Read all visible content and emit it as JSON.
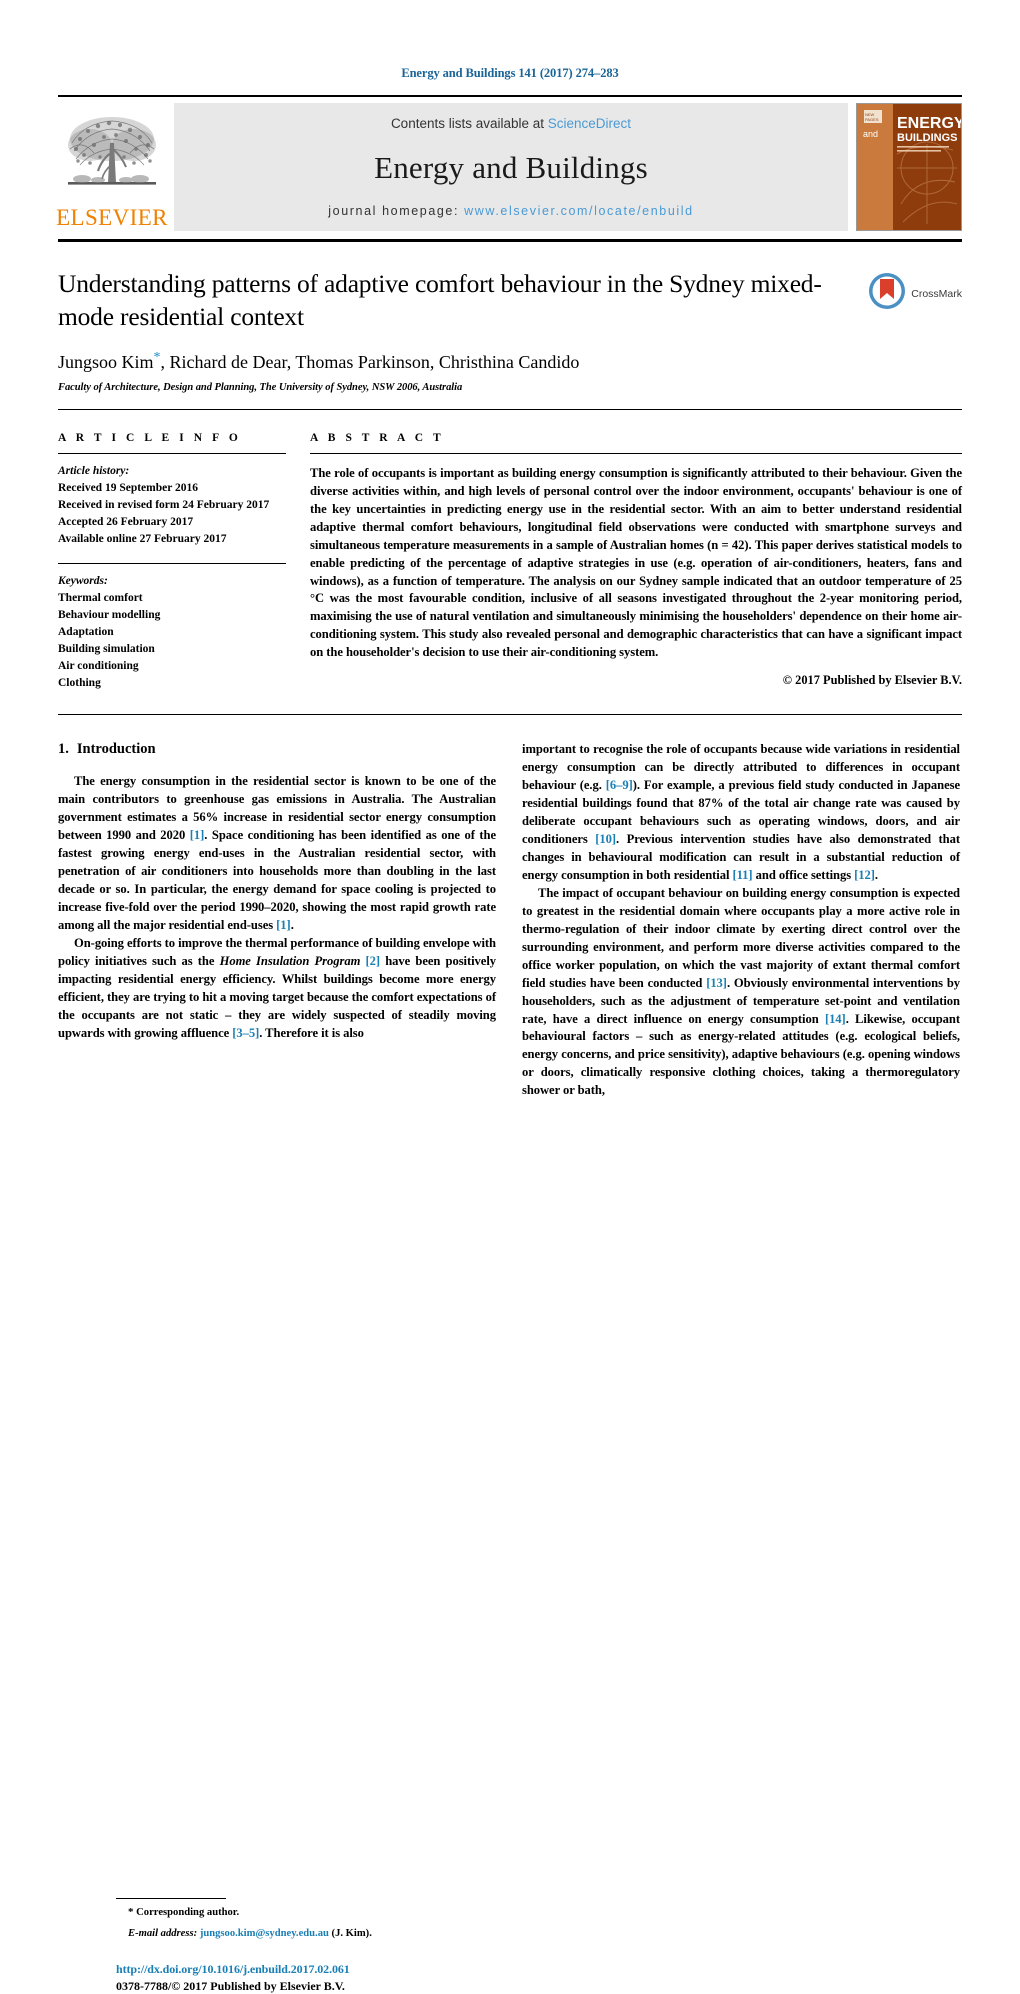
{
  "running_head": "Energy and Buildings 141 (2017) 274–283",
  "masthead": {
    "contents_prefix": "Contents lists available at ",
    "sciencedirect": "ScienceDirect",
    "journal_name": "Energy and Buildings",
    "homepage_prefix": "journal homepage: ",
    "homepage_url": "www.elsevier.com/locate/enbuild",
    "publisher_logo_text": "ELSEVIER",
    "cover_title_line1": "ENERGY",
    "cover_title_line2": "BUILDINGS",
    "cover_and": "and",
    "accent_blue": "#4a9ad4",
    "accent_orange": "#F08000",
    "cover_brown": "#8a3a10"
  },
  "article": {
    "title": "Understanding patterns of adaptive comfort behaviour in the Sydney mixed-mode residential context",
    "authors": "Jungsoo Kim",
    "authors_rest": ", Richard de Dear, Thomas Parkinson, Christhina Candido",
    "corresponding_marker": "*",
    "affiliation": "Faculty of Architecture, Design and Planning, The University of Sydney, NSW 2006, Australia",
    "crossmark_label": "CrossMark"
  },
  "article_info": {
    "heading": "A R T I C L E  I N F O",
    "history_label": "Article history:",
    "history": [
      "Received 19 September 2016",
      "Received in revised form 24 February 2017",
      "Accepted 26 February 2017",
      "Available online 27 February 2017"
    ],
    "keywords_label": "Keywords:",
    "keywords": [
      "Thermal comfort",
      "Behaviour modelling",
      "Adaptation",
      "Building simulation",
      "Air conditioning",
      "Clothing"
    ]
  },
  "abstract": {
    "heading": "A B S T R A C T",
    "text": "The role of occupants is important as building energy consumption is significantly attributed to their behaviour. Given the diverse activities within, and high levels of personal control over the indoor environment, occupants' behaviour is one of the key uncertainties in predicting energy use in the residential sector. With an aim to better understand residential adaptive thermal comfort behaviours, longitudinal field observations were conducted with smartphone surveys and simultaneous temperature measurements in a sample of Australian homes (n = 42). This paper derives statistical models to enable predicting of the percentage of adaptive strategies in use (e.g. operation of air-conditioners, heaters, fans and windows), as a function of temperature. The analysis on our Sydney sample indicated that an outdoor temperature of 25 °C was the most favourable condition, inclusive of all seasons investigated throughout the 2-year monitoring period, maximising the use of natural ventilation and simultaneously minimising the householders' dependence on their home air-conditioning system. This study also revealed personal and demographic characteristics that can have a significant impact on the householder's decision to use their air-conditioning system.",
    "copyright": "© 2017 Published by Elsevier B.V."
  },
  "introduction": {
    "number": "1.",
    "title": "Introduction",
    "left_paragraphs": [
      "The energy consumption in the residential sector is known to be one of the main contributors to greenhouse gas emissions in Australia. The Australian government estimates a 56% increase in residential sector energy consumption between 1990 and 2020 [1]. Space conditioning has been identified as one of the fastest growing energy end-uses in the Australian residential sector, with penetration of air conditioners into households more than doubling in the last decade or so. In particular, the energy demand for space cooling is projected to increase five-fold over the period 1990–2020, showing the most rapid growth rate among all the major residential end-uses [1].",
      "On-going efforts to improve the thermal performance of building envelope with policy initiatives such as the Home Insulation Program [2] have been positively impacting residential energy efficiency. Whilst buildings become more energy efficient, they are trying to hit a moving target because the comfort expectations of the occupants are not static – they are widely suspected of steadily moving upwards with growing affluence [3–5]. Therefore it is also"
    ],
    "right_paragraphs": [
      "important to recognise the role of occupants because wide variations in residential energy consumption can be directly attributed to differences in occupant behaviour (e.g. [6–9]). For example, a previous field study conducted in Japanese residential buildings found that 87% of the total air change rate was caused by deliberate occupant behaviours such as operating windows, doors, and air conditioners [10]. Previous intervention studies have also demonstrated that changes in behavioural modification can result in a substantial reduction of energy consumption in both residential [11] and office settings [12].",
      "The impact of occupant behaviour on building energy consumption is expected to greatest in the residential domain where occupants play a more active role in thermo-regulation of their indoor climate by exerting direct control over the surrounding environment, and perform more diverse activities compared to the office worker population, on which the vast majority of extant thermal comfort field studies have been conducted [13]. Obviously environmental interventions by householders, such as the adjustment of temperature set-point and ventilation rate, have a direct influence on energy consumption [14]. Likewise, occupant behavioural factors – such as energy-related attitudes (e.g. ecological beliefs, energy concerns, and price sensitivity), adaptive behaviours (e.g. opening windows or doors, climatically responsive clothing choices, taking a thermoregulatory shower or bath,"
    ]
  },
  "footer": {
    "corresponding_marker": "*",
    "corresponding_text": "Corresponding author.",
    "email_label": "E-mail address:",
    "email": "jungsoo.kim@sydney.edu.au",
    "email_suffix": "(J. Kim).",
    "doi": "http://dx.doi.org/10.1016/j.enbuild.2017.02.061",
    "issn": "0378-7788/© 2017 Published by Elsevier B.V."
  }
}
